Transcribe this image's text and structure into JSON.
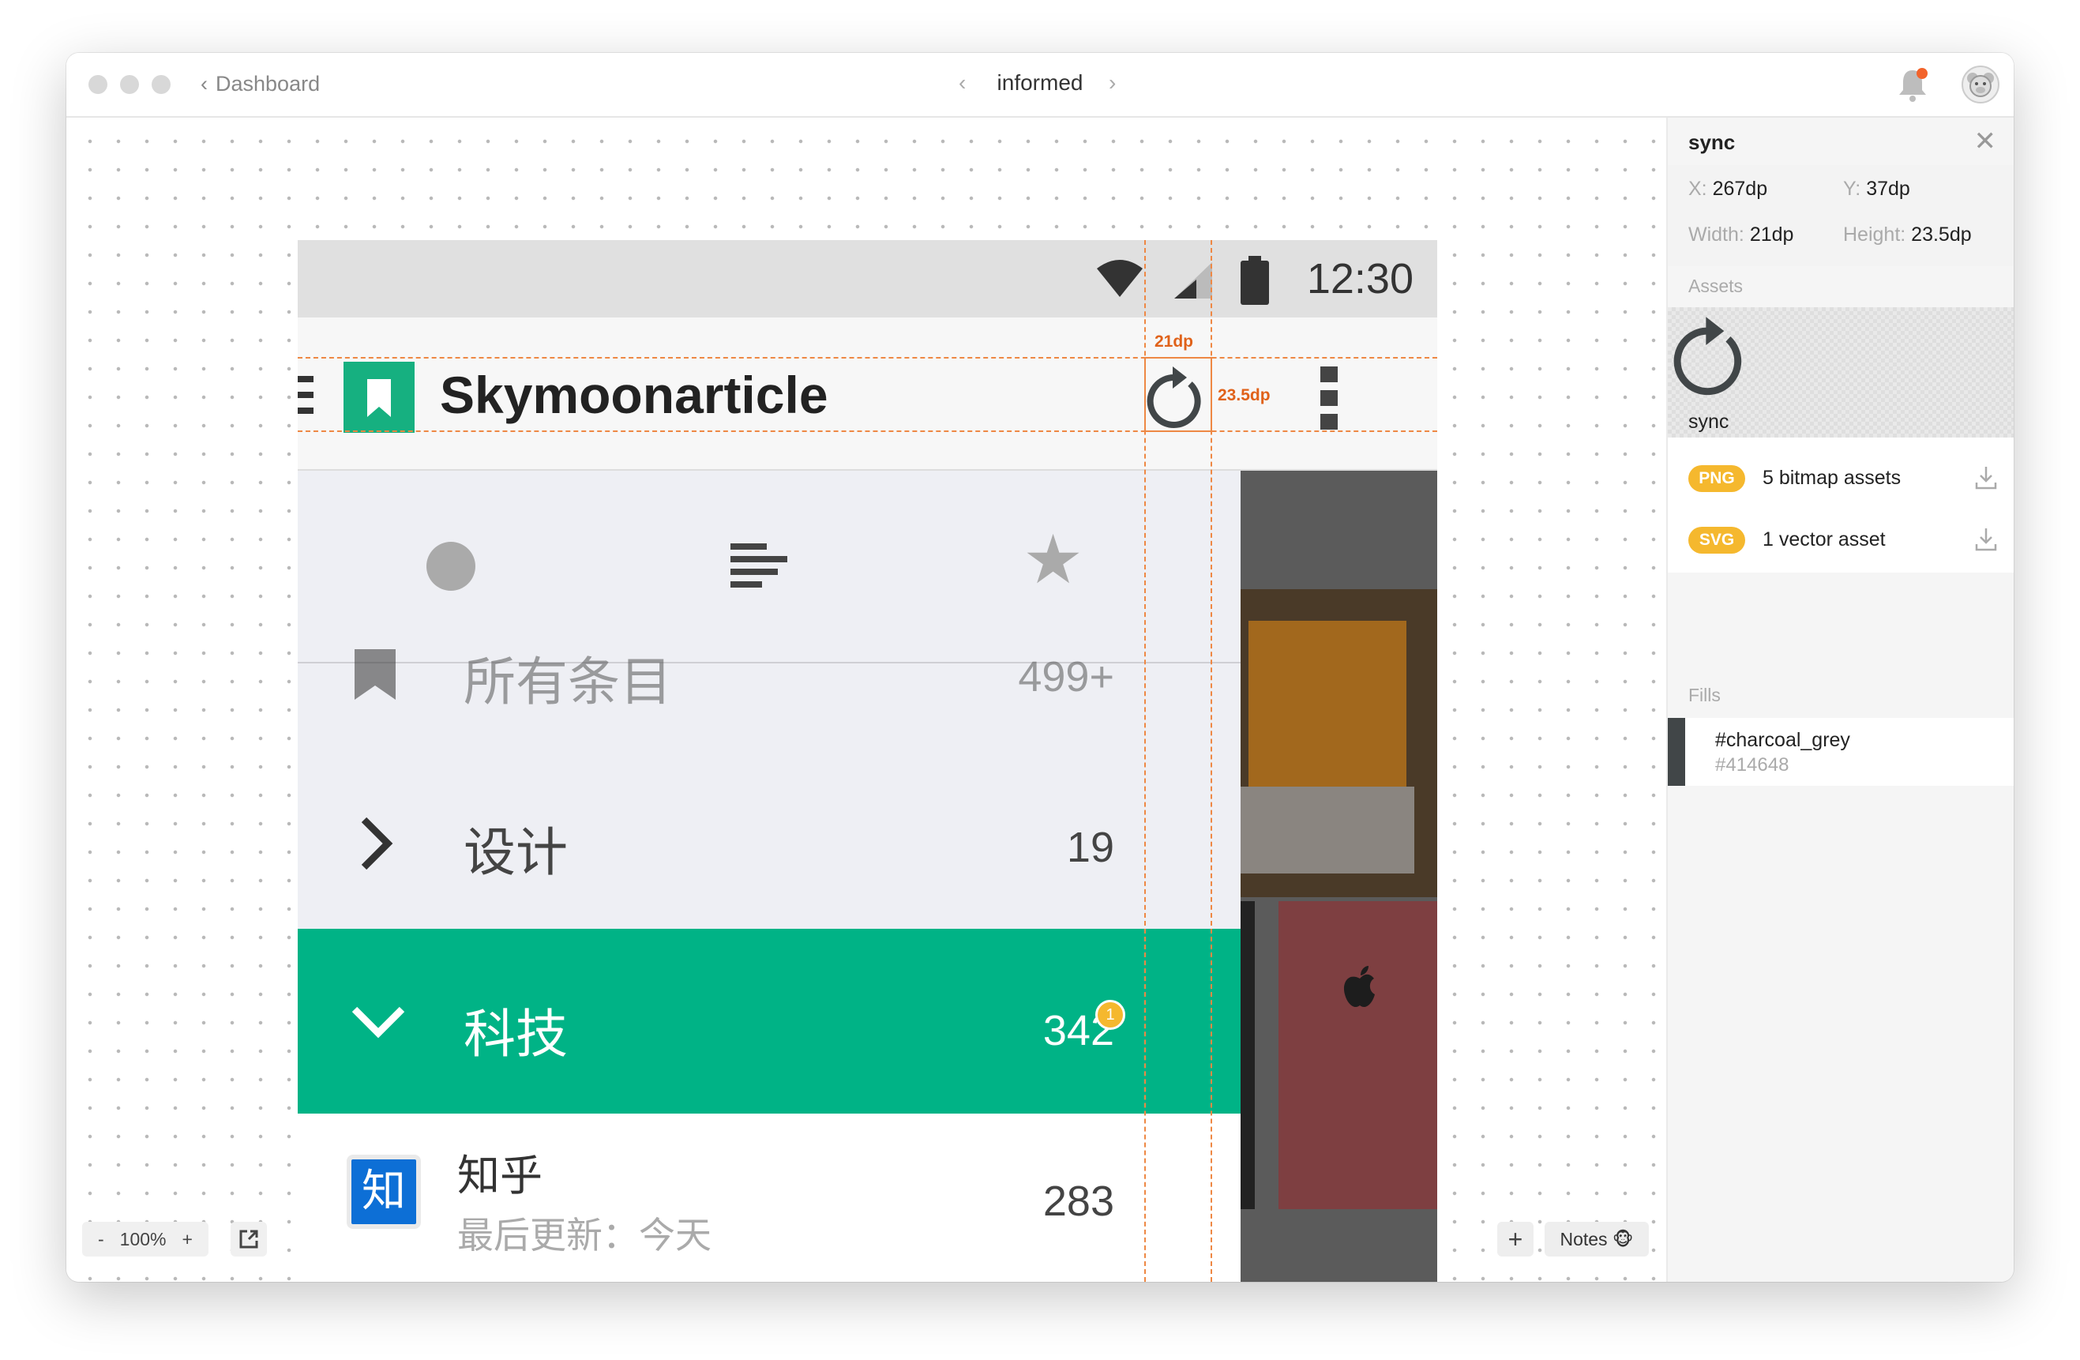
{
  "titlebar": {
    "back_label": "Dashboard",
    "back_chevron": "‹",
    "center_title": "informed",
    "prev_chevron": "‹",
    "next_chevron": "›"
  },
  "phone": {
    "status_time": "12:30",
    "app_title": "Skymoonarticle",
    "drawer": {
      "items": [
        {
          "label": "所有条目",
          "count": "499+"
        },
        {
          "label": "设计",
          "count": "19"
        },
        {
          "label": "科技",
          "count": "342",
          "badge": "1"
        }
      ],
      "feed": {
        "logo_text": "知",
        "title": "知乎",
        "subtitle": "最后更新：今天",
        "count": "283"
      }
    }
  },
  "measurements": {
    "width": "21dp",
    "height": "23.5dp"
  },
  "canvas_controls": {
    "zoom_minus": "-",
    "zoom_level": "100%",
    "zoom_plus": "+",
    "add": "+",
    "notes": "Notes 🐵"
  },
  "panel": {
    "title": "sync",
    "close": "✕",
    "props": {
      "x_key": "X:",
      "x_val": "267dp",
      "y_key": "Y:",
      "y_val": "37dp",
      "w_key": "Width:",
      "w_val": "21dp",
      "h_key": "Height:",
      "h_val": "23.5dp"
    },
    "assets_heading": "Assets",
    "asset_name": "sync",
    "downloads": [
      {
        "badge": "PNG",
        "label": "5 bitmap assets"
      },
      {
        "badge": "SVG",
        "label": "1 vector asset"
      }
    ],
    "fills_heading": "Fills",
    "fill": {
      "name": "#charcoal_grey",
      "hex": "#414648",
      "color": "#414648"
    }
  },
  "colors": {
    "accent_green": "#00b386",
    "badge_yellow": "#f5b82e",
    "measure_orange": "#ee8844"
  }
}
